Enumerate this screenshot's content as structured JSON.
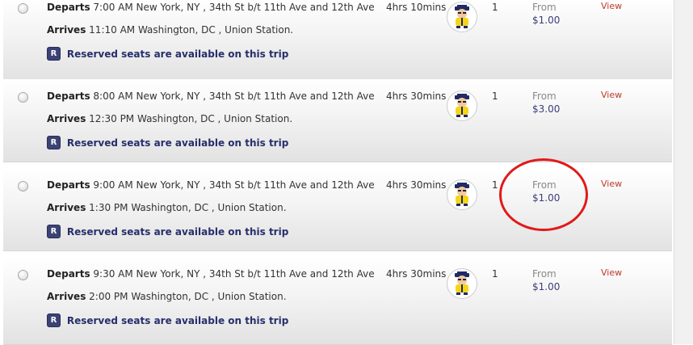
{
  "trips": [
    {
      "departs_label": "Departs",
      "departs_text": "7:00 AM New York, NY , 34th St b/t 11th Ave and 12th Ave",
      "arrives_label": "Arrives",
      "arrives_text": "11:10 AM Washington, DC , Union Station.",
      "reserved_badge": "R",
      "reserved_text": "Reserved seats are available on this trip",
      "duration": "4hrs 10mins",
      "seats": "1",
      "from_label": "From",
      "price": "$1.00",
      "view_label": "View"
    },
    {
      "departs_label": "Departs",
      "departs_text": "8:00 AM New York, NY , 34th St b/t 11th Ave and 12th Ave",
      "arrives_label": "Arrives",
      "arrives_text": "12:30 PM Washington, DC , Union Station.",
      "reserved_badge": "R",
      "reserved_text": "Reserved seats are available on this trip",
      "duration": "4hrs 30mins",
      "seats": "1",
      "from_label": "From",
      "price": "$3.00",
      "view_label": "View"
    },
    {
      "departs_label": "Departs",
      "departs_text": "9:00 AM New York, NY , 34th St b/t 11th Ave and 12th Ave",
      "arrives_label": "Arrives",
      "arrives_text": "1:30 PM Washington, DC , Union Station.",
      "reserved_badge": "R",
      "reserved_text": "Reserved seats are available on this trip",
      "duration": "4hrs 30mins",
      "seats": "1",
      "from_label": "From",
      "price": "$1.00",
      "view_label": "View"
    },
    {
      "departs_label": "Departs",
      "departs_text": "9:30 AM New York, NY , 34th St b/t 11th Ave and 12th Ave",
      "arrives_label": "Arrives",
      "arrives_text": "2:00 PM Washington, DC , Union Station.",
      "reserved_badge": "R",
      "reserved_text": "Reserved seats are available on this trip",
      "duration": "4hrs 30mins",
      "seats": "1",
      "from_label": "From",
      "price": "$1.00",
      "view_label": "View"
    }
  ],
  "icons": {
    "bus_mascot": "bus-mascot-icon",
    "reserved": "reserved-r-icon"
  },
  "colors": {
    "reserved_text": "#262f6b",
    "price": "#3d3d7a",
    "view_link": "#c0392b",
    "annotation_circle": "#e01a1a"
  }
}
